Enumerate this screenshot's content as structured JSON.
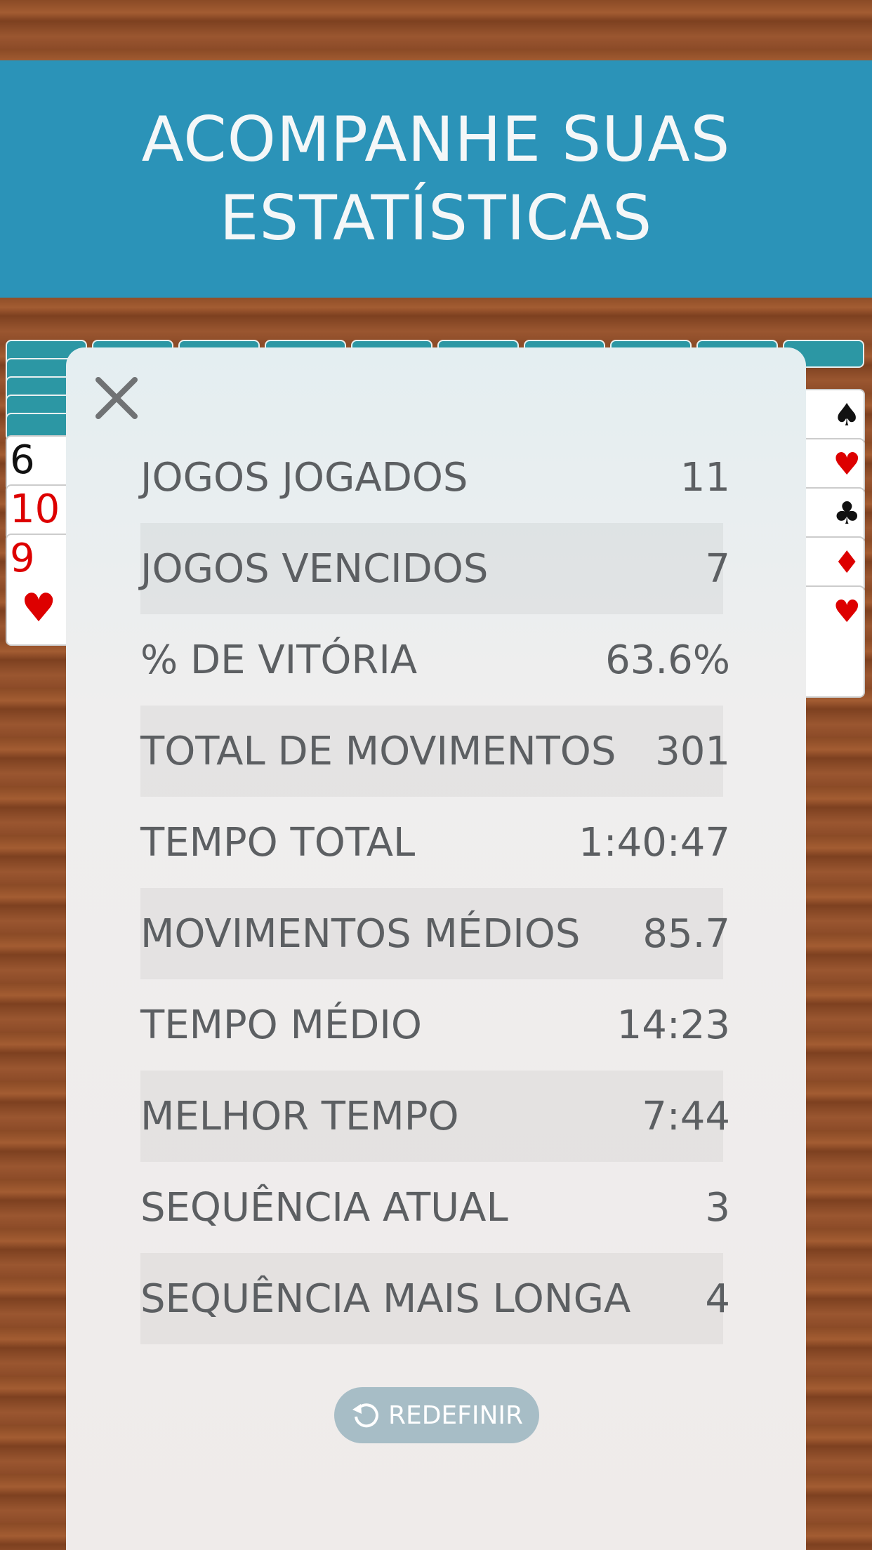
{
  "banner": {
    "line1": "ACOMPANHE SUAS",
    "line2": "ESTATÍSTICAS"
  },
  "tableau": {
    "left_cards": [
      "6",
      "10",
      "9"
    ],
    "icons": [
      "spade-icon",
      "heart-icon",
      "club-icon",
      "diamond-icon"
    ]
  },
  "stats": [
    {
      "label": "JOGOS JOGADOS",
      "value": "11"
    },
    {
      "label": "JOGOS VENCIDOS",
      "value": "7"
    },
    {
      "label": "% DE VITÓRIA",
      "value": "63.6%"
    },
    {
      "label": "TOTAL DE MOVIMENTOS",
      "value": "301"
    },
    {
      "label": "TEMPO TOTAL",
      "value": "1:40:47"
    },
    {
      "label": "MOVIMENTOS MÉDIOS",
      "value": "85.7"
    },
    {
      "label": "TEMPO MÉDIO",
      "value": "14:23"
    },
    {
      "label": "MELHOR TEMPO",
      "value": "7:44"
    },
    {
      "label": "SEQUÊNCIA ATUAL",
      "value": "3"
    },
    {
      "label": "SEQUÊNCIA MAIS LONGA",
      "value": "4"
    }
  ],
  "reset_button": {
    "label": "REDEFINIR",
    "icon": "reset-icon"
  },
  "colors": {
    "banner": "#2b93b8",
    "button": "#a7bdc6",
    "text": "#5c5f62"
  }
}
